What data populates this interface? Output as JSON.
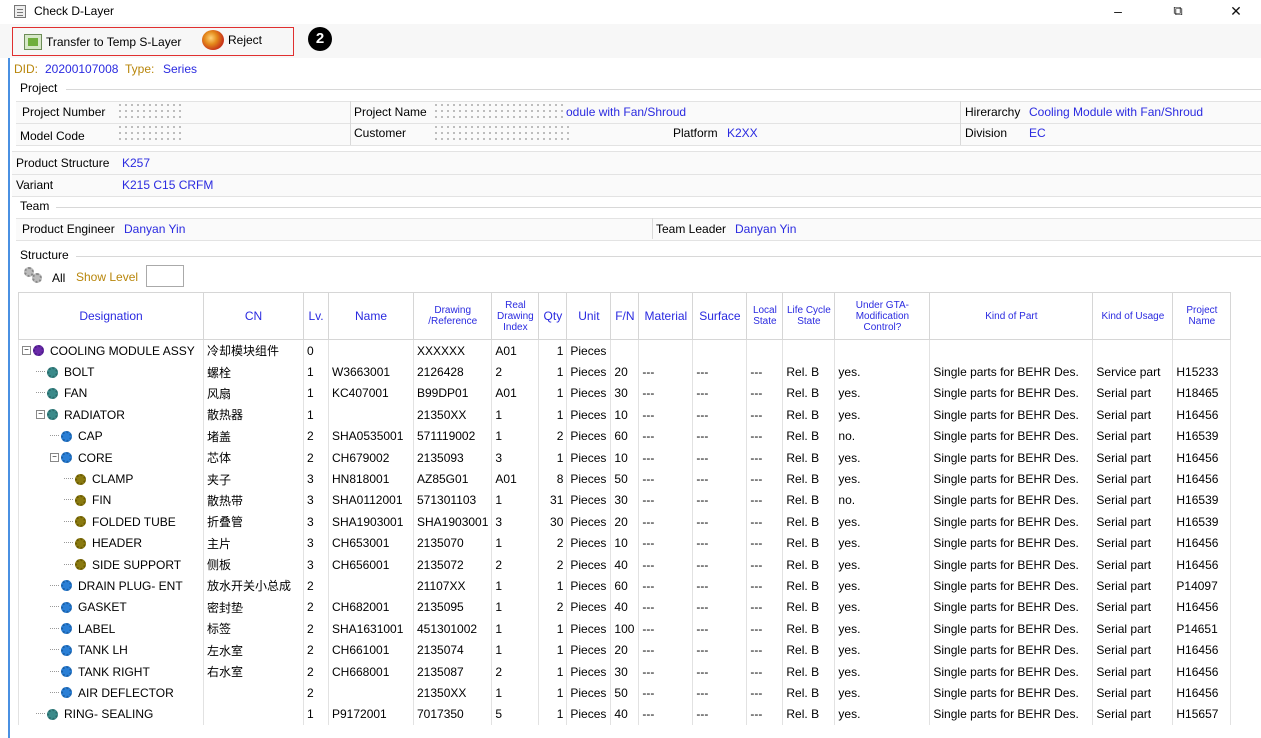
{
  "window": {
    "title": "Check D-Layer",
    "minimize": "–",
    "restore": "⧉",
    "close": "✕"
  },
  "toolbar": {
    "transfer_label": "Transfer to Temp S-Layer",
    "reject_label": "Reject",
    "callout": "2"
  },
  "header": {
    "did_label": "DID:",
    "did_value": "20200107008",
    "type_label": "Type:",
    "type_value": "Series"
  },
  "project": {
    "section": "Project",
    "project_number_label": "Project Number",
    "project_name_label": "Project Name",
    "project_name_value": "odule with Fan/Shroud",
    "hierarchy_label": "Hirerarchy",
    "hierarchy_value": "Cooling Module with Fan/Shroud",
    "model_code_label": "Model Code",
    "customer_label": "Customer",
    "platform_label": "Platform",
    "platform_value": "K2XX",
    "division_label": "Division",
    "division_value": "EC"
  },
  "product": {
    "structure_label": "Product Structure",
    "structure_value": "K257",
    "variant_label": "Variant",
    "variant_value": "K215 C15 CRFM"
  },
  "team": {
    "section": "Team",
    "engineer_label": "Product Engineer",
    "engineer_value": "Danyan Yin",
    "leader_label": "Team Leader",
    "leader_value": "Danyan Yin"
  },
  "structure": {
    "section": "Structure",
    "all_label": "All",
    "show_level_label": "Show Level"
  },
  "table": {
    "columns": [
      "Designation",
      "CN",
      "Lv.",
      "Name",
      "Drawing /Reference",
      "Real Drawing Index",
      "Qty",
      "Unit",
      "F/N",
      "Material",
      "Surface",
      "Local State",
      "Life Cycle State",
      "Under GTA-Modification Control?",
      "Kind of Part",
      "Kind of Usage",
      "Project Name"
    ],
    "rows": [
      {
        "designation": "COOLING MODULE ASSY",
        "cn": "冷却模块组件",
        "lv": "0",
        "name": "",
        "drawing": "XXXXXX",
        "index": "A01",
        "qty": "1",
        "unit": "Pieces",
        "fn": "",
        "material": "",
        "surface": "",
        "local": "",
        "lifecycle": "",
        "gta": "",
        "kind_part": "",
        "kind_usage": "",
        "project": ""
      },
      {
        "designation": "BOLT",
        "cn": "螺栓",
        "lv": "1",
        "name": "W3663001",
        "drawing": "2126428",
        "index": "2",
        "qty": "1",
        "unit": "Pieces",
        "fn": "20",
        "material": "---",
        "surface": "---",
        "local": "---",
        "lifecycle": "Rel. B",
        "gta": "yes.",
        "kind_part": "Single parts for BEHR Des.",
        "kind_usage": "Service part",
        "project": "H15233"
      },
      {
        "designation": "FAN",
        "cn": "风扇",
        "lv": "1",
        "name": "KC407001",
        "drawing": "B99DP01",
        "index": "A01",
        "qty": "1",
        "unit": "Pieces",
        "fn": "30",
        "material": "---",
        "surface": "---",
        "local": "---",
        "lifecycle": "Rel. B",
        "gta": "yes.",
        "kind_part": "Single parts for BEHR Des.",
        "kind_usage": "Serial part",
        "project": "H18465"
      },
      {
        "designation": "RADIATOR",
        "cn": "散热器",
        "lv": "1",
        "name": "",
        "drawing": "21350XX",
        "index": "1",
        "qty": "1",
        "unit": "Pieces",
        "fn": "10",
        "material": "---",
        "surface": "---",
        "local": "---",
        "lifecycle": "Rel. B",
        "gta": "yes.",
        "kind_part": "Single parts for BEHR Des.",
        "kind_usage": "Serial part",
        "project": "H16456"
      },
      {
        "designation": "CAP",
        "cn": "堵盖",
        "lv": "2",
        "name": "SHA0535001",
        "drawing": "571119002",
        "index": "1",
        "qty": "2",
        "unit": "Pieces",
        "fn": "60",
        "material": "---",
        "surface": "---",
        "local": "---",
        "lifecycle": "Rel. B",
        "gta": "no.",
        "kind_part": "Single parts for BEHR Des.",
        "kind_usage": "Serial part",
        "project": "H16539"
      },
      {
        "designation": "CORE",
        "cn": "芯体",
        "lv": "2",
        "name": "CH679002",
        "drawing": "2135093",
        "index": "3",
        "qty": "1",
        "unit": "Pieces",
        "fn": "10",
        "material": "---",
        "surface": "---",
        "local": "---",
        "lifecycle": "Rel. B",
        "gta": "yes.",
        "kind_part": "Single parts for BEHR Des.",
        "kind_usage": "Serial part",
        "project": "H16456"
      },
      {
        "designation": "CLAMP",
        "cn": "夹子",
        "lv": "3",
        "name": "HN818001",
        "drawing": "AZ85G01",
        "index": "A01",
        "qty": "8",
        "unit": "Pieces",
        "fn": "50",
        "material": "---",
        "surface": "---",
        "local": "---",
        "lifecycle": "Rel. B",
        "gta": "yes.",
        "kind_part": "Single parts for BEHR Des.",
        "kind_usage": "Serial part",
        "project": "H16456"
      },
      {
        "designation": "FIN",
        "cn": "散热带",
        "lv": "3",
        "name": "SHA0112001",
        "drawing": "571301103",
        "index": "1",
        "qty": "31",
        "unit": "Pieces",
        "fn": "30",
        "material": "---",
        "surface": "---",
        "local": "---",
        "lifecycle": "Rel. B",
        "gta": "no.",
        "kind_part": "Single parts for BEHR Des.",
        "kind_usage": "Serial part",
        "project": "H16539"
      },
      {
        "designation": "FOLDED TUBE",
        "cn": "折叠管",
        "lv": "3",
        "name": "SHA1903001",
        "drawing": "SHA1903001",
        "index": "3",
        "qty": "30",
        "unit": "Pieces",
        "fn": "20",
        "material": "---",
        "surface": "---",
        "local": "---",
        "lifecycle": "Rel. B",
        "gta": "yes.",
        "kind_part": "Single parts for BEHR Des.",
        "kind_usage": "Serial part",
        "project": "H16539"
      },
      {
        "designation": "HEADER",
        "cn": "主片",
        "lv": "3",
        "name": "CH653001",
        "drawing": "2135070",
        "index": "1",
        "qty": "2",
        "unit": "Pieces",
        "fn": "10",
        "material": "---",
        "surface": "---",
        "local": "---",
        "lifecycle": "Rel. B",
        "gta": "yes.",
        "kind_part": "Single parts for BEHR Des.",
        "kind_usage": "Serial part",
        "project": "H16456"
      },
      {
        "designation": "SIDE SUPPORT",
        "cn": "侧板",
        "lv": "3",
        "name": "CH656001",
        "drawing": "2135072",
        "index": "2",
        "qty": "2",
        "unit": "Pieces",
        "fn": "40",
        "material": "---",
        "surface": "---",
        "local": "---",
        "lifecycle": "Rel. B",
        "gta": "yes.",
        "kind_part": "Single parts for BEHR Des.",
        "kind_usage": "Serial part",
        "project": "H16456"
      },
      {
        "designation": "DRAIN PLUG- ENT",
        "cn": "放水开关小总成",
        "lv": "2",
        "name": "",
        "drawing": "21107XX",
        "index": "1",
        "qty": "1",
        "unit": "Pieces",
        "fn": "60",
        "material": "---",
        "surface": "---",
        "local": "---",
        "lifecycle": "Rel. B",
        "gta": "yes.",
        "kind_part": "Single parts for BEHR Des.",
        "kind_usage": "Serial part",
        "project": "P14097"
      },
      {
        "designation": "GASKET",
        "cn": "密封垫",
        "lv": "2",
        "name": "CH682001",
        "drawing": "2135095",
        "index": "1",
        "qty": "2",
        "unit": "Pieces",
        "fn": "40",
        "material": "---",
        "surface": "---",
        "local": "---",
        "lifecycle": "Rel. B",
        "gta": "yes.",
        "kind_part": "Single parts for BEHR Des.",
        "kind_usage": "Serial part",
        "project": "H16456"
      },
      {
        "designation": "LABEL",
        "cn": "标签",
        "lv": "2",
        "name": "SHA1631001",
        "drawing": "451301002",
        "index": "1",
        "qty": "1",
        "unit": "Pieces",
        "fn": "100",
        "material": "---",
        "surface": "---",
        "local": "---",
        "lifecycle": "Rel. B",
        "gta": "yes.",
        "kind_part": "Single parts for BEHR Des.",
        "kind_usage": "Serial part",
        "project": "P14651"
      },
      {
        "designation": "TANK LH",
        "cn": "左水室",
        "lv": "2",
        "name": "CH661001",
        "drawing": "2135074",
        "index": "1",
        "qty": "1",
        "unit": "Pieces",
        "fn": "20",
        "material": "---",
        "surface": "---",
        "local": "---",
        "lifecycle": "Rel. B",
        "gta": "yes.",
        "kind_part": "Single parts for BEHR Des.",
        "kind_usage": "Serial part",
        "project": "H16456"
      },
      {
        "designation": "TANK RIGHT",
        "cn": "右水室",
        "lv": "2",
        "name": "CH668001",
        "drawing": "2135087",
        "index": "2",
        "qty": "1",
        "unit": "Pieces",
        "fn": "30",
        "material": "---",
        "surface": "---",
        "local": "---",
        "lifecycle": "Rel. B",
        "gta": "yes.",
        "kind_part": "Single parts for BEHR Des.",
        "kind_usage": "Serial part",
        "project": "H16456"
      },
      {
        "designation": "AIR DEFLECTOR",
        "cn": "",
        "lv": "2",
        "name": "",
        "drawing": "21350XX",
        "index": "1",
        "qty": "1",
        "unit": "Pieces",
        "fn": "50",
        "material": "---",
        "surface": "---",
        "local": "---",
        "lifecycle": "Rel. B",
        "gta": "yes.",
        "kind_part": "Single parts for BEHR Des.",
        "kind_usage": "Serial part",
        "project": "H16456"
      },
      {
        "designation": "RING- SEALING",
        "cn": "",
        "lv": "1",
        "name": "P9172001",
        "drawing": "7017350",
        "index": "5",
        "qty": "1",
        "unit": "Pieces",
        "fn": "40",
        "material": "---",
        "surface": "---",
        "local": "---",
        "lifecycle": "Rel. B",
        "gta": "yes.",
        "kind_part": "Single parts for BEHR Des.",
        "kind_usage": "Serial part",
        "project": "H15657"
      }
    ]
  },
  "colors": {
    "link": "#2a2ae0",
    "callout_border": "#e03030",
    "accent": "#4a90e2"
  }
}
